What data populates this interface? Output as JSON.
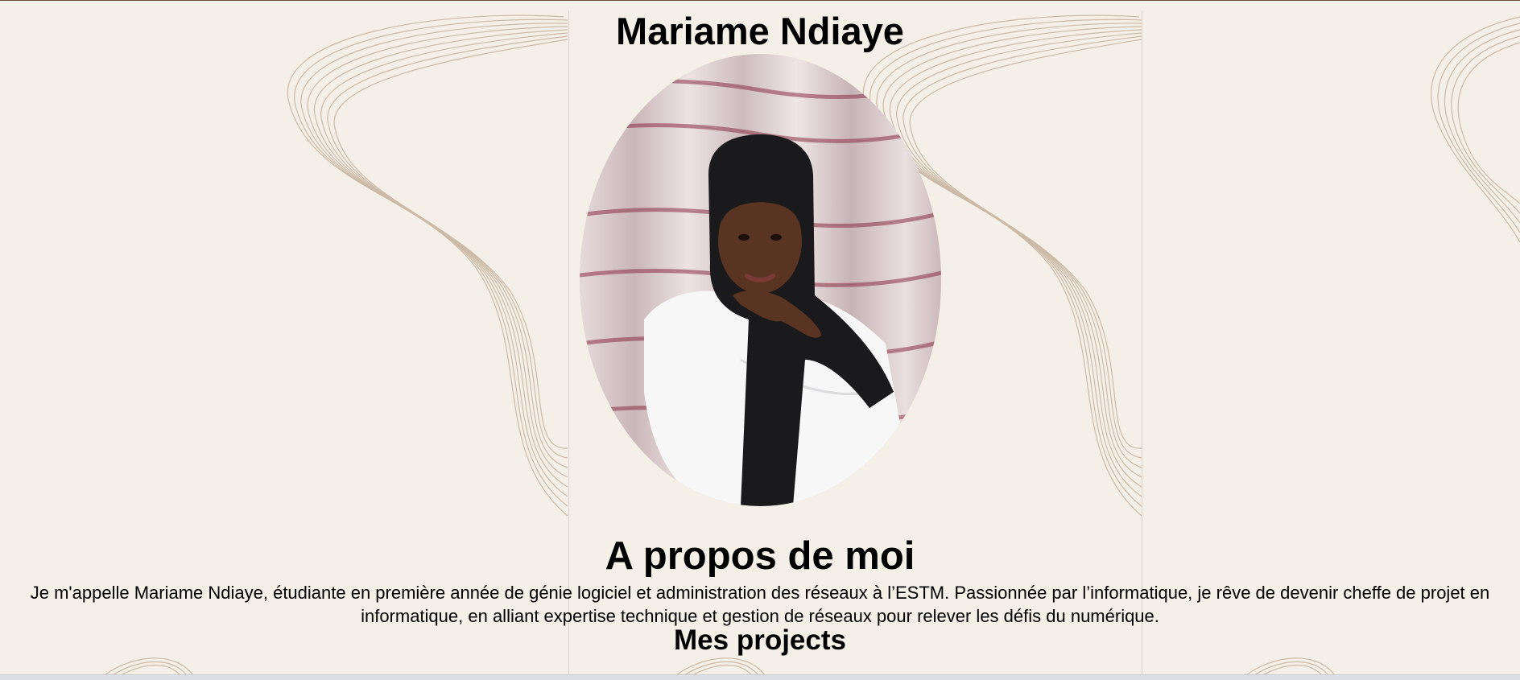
{
  "header": {
    "name": "Mariame Ndiaye"
  },
  "portrait": {
    "alt": "Portrait de Mariame Ndiaye"
  },
  "about": {
    "title": "A propos de moi",
    "text": "Je m'appelle Mariame Ndiaye, étudiante en première année de génie logiciel et administration des réseaux à l’ESTM. Passionnée par l’informatique, je rêve de devenir cheffe de projet en informatique, en alliant expertise technique et gestion de réseaux pour relever les défis du numérique."
  },
  "projects": {
    "title": "Mes projects"
  },
  "colors": {
    "background": "#f4efe7",
    "wave": "#c4b19c",
    "text": "#000000"
  }
}
